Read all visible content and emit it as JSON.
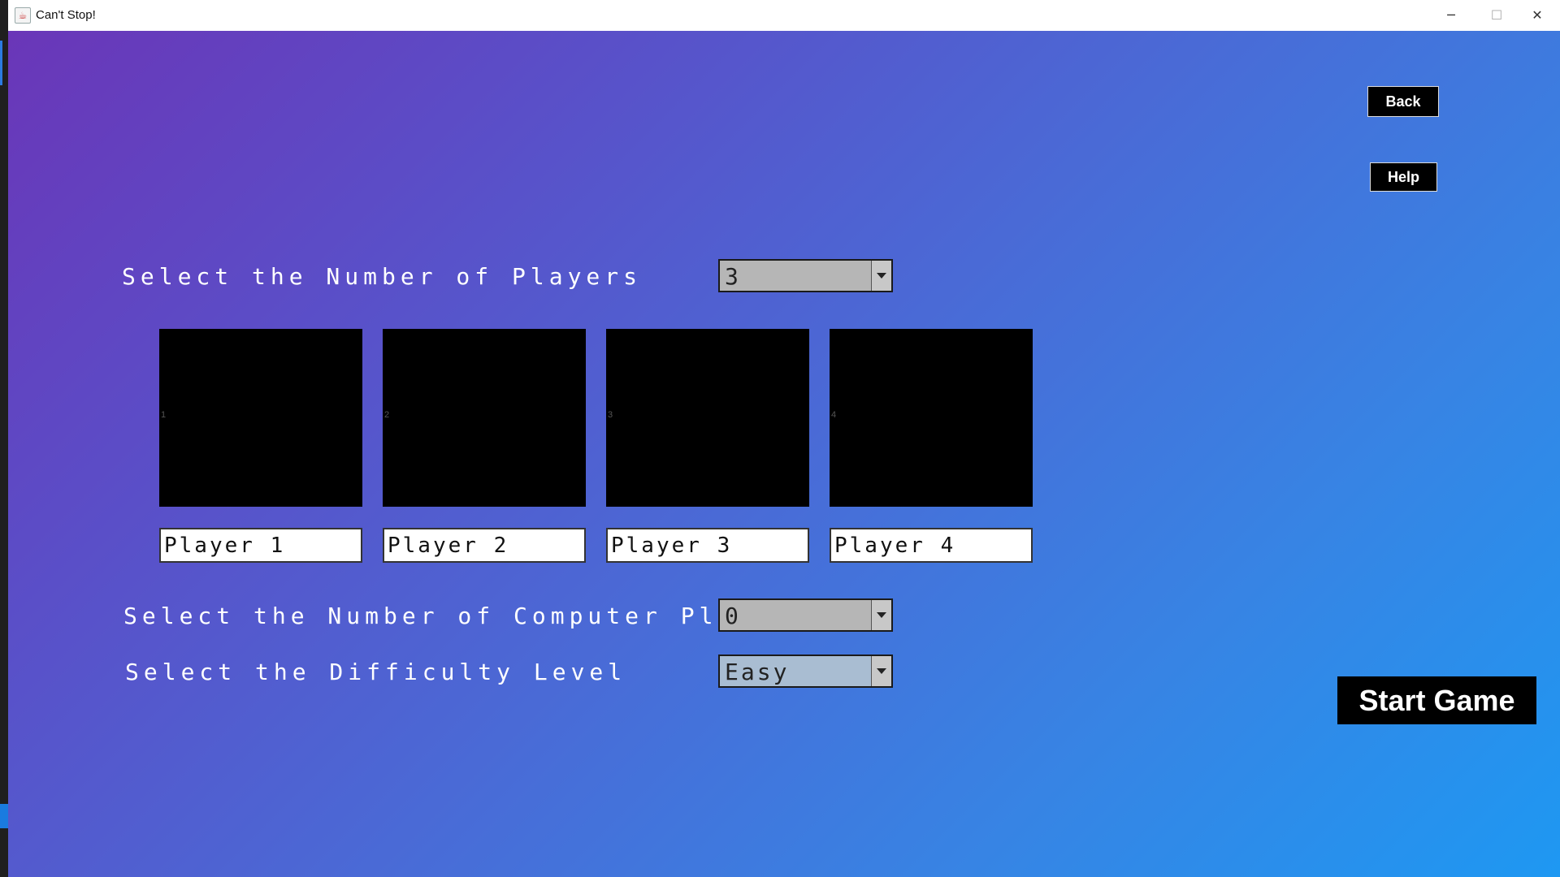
{
  "window": {
    "title": "Can't Stop!",
    "controls": {
      "minimize": "─",
      "maximize": "☐",
      "close": "✕"
    }
  },
  "buttons": {
    "back": "Back",
    "help": "Help",
    "start": "Start Game"
  },
  "players_section": {
    "label": "Select the Number of Players",
    "selected": "3"
  },
  "slots": [
    {
      "number": "1",
      "name": "Player 1"
    },
    {
      "number": "2",
      "name": "Player 2"
    },
    {
      "number": "3",
      "name": "Player 3"
    },
    {
      "number": "4",
      "name": "Player 4"
    }
  ],
  "computer_section": {
    "label": "Select the Number of Computer Players",
    "selected": "0"
  },
  "difficulty_section": {
    "label": "Select the Difficulty Level",
    "selected": "Easy"
  },
  "colors": {
    "gradient_start": "#6a36b8",
    "gradient_end": "#1e98f2",
    "button_bg": "#000000"
  }
}
